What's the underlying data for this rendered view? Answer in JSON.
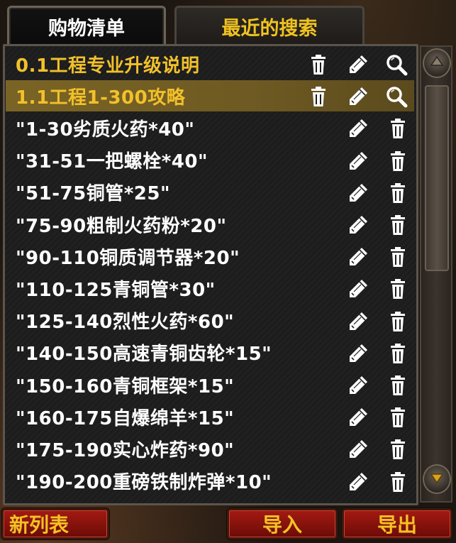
{
  "tabs": [
    {
      "label": "购物清单",
      "active": true
    },
    {
      "label": "最近的搜索",
      "active": false
    }
  ],
  "rows": [
    {
      "label": "0.1工程专业升级说明",
      "color": "gold",
      "highlight": false,
      "icons": [
        "trash-icon",
        "pencil-icon",
        "magnifier-icon"
      ]
    },
    {
      "label": "1.1工程1-300攻略",
      "color": "gold",
      "highlight": true,
      "icons": [
        "trash-icon",
        "pencil-icon",
        "magnifier-icon"
      ]
    },
    {
      "label": "\"1-30劣质火药*40\"",
      "color": "white",
      "highlight": false,
      "icons": [
        "pencil-icon",
        "trash-icon"
      ]
    },
    {
      "label": "\"31-51一把螺栓*40\"",
      "color": "white",
      "highlight": false,
      "icons": [
        "pencil-icon",
        "trash-icon"
      ]
    },
    {
      "label": "\"51-75铜管*25\"",
      "color": "white",
      "highlight": false,
      "icons": [
        "pencil-icon",
        "trash-icon"
      ]
    },
    {
      "label": "\"75-90粗制火药粉*20\"",
      "color": "white",
      "highlight": false,
      "icons": [
        "pencil-icon",
        "trash-icon"
      ]
    },
    {
      "label": "\"90-110铜质调节器*20\"",
      "color": "white",
      "highlight": false,
      "icons": [
        "pencil-icon",
        "trash-icon"
      ]
    },
    {
      "label": "\"110-125青铜管*30\"",
      "color": "white",
      "highlight": false,
      "icons": [
        "pencil-icon",
        "trash-icon"
      ]
    },
    {
      "label": "\"125-140烈性火药*60\"",
      "color": "white",
      "highlight": false,
      "icons": [
        "pencil-icon",
        "trash-icon"
      ]
    },
    {
      "label": "\"140-150高速青铜齿轮*15\"",
      "color": "white",
      "highlight": false,
      "icons": [
        "pencil-icon",
        "trash-icon"
      ]
    },
    {
      "label": "\"150-160青铜框架*15\"",
      "color": "white",
      "highlight": false,
      "icons": [
        "pencil-icon",
        "trash-icon"
      ]
    },
    {
      "label": "\"160-175自爆绵羊*15\"",
      "color": "white",
      "highlight": false,
      "icons": [
        "pencil-icon",
        "trash-icon"
      ]
    },
    {
      "label": "\"175-190实心炸药*90\"",
      "color": "white",
      "highlight": false,
      "icons": [
        "pencil-icon",
        "trash-icon"
      ]
    },
    {
      "label": "\"190-200重磅铁制炸弹*10\"",
      "color": "white",
      "highlight": false,
      "icons": [
        "pencil-icon",
        "trash-icon"
      ]
    }
  ],
  "buttons": {
    "new_list": "新列表",
    "import": "导入",
    "export": "导出"
  },
  "colors": {
    "gold": "#f2c12a",
    "highlight": "#7a6425",
    "button_red": "#a31a12"
  }
}
